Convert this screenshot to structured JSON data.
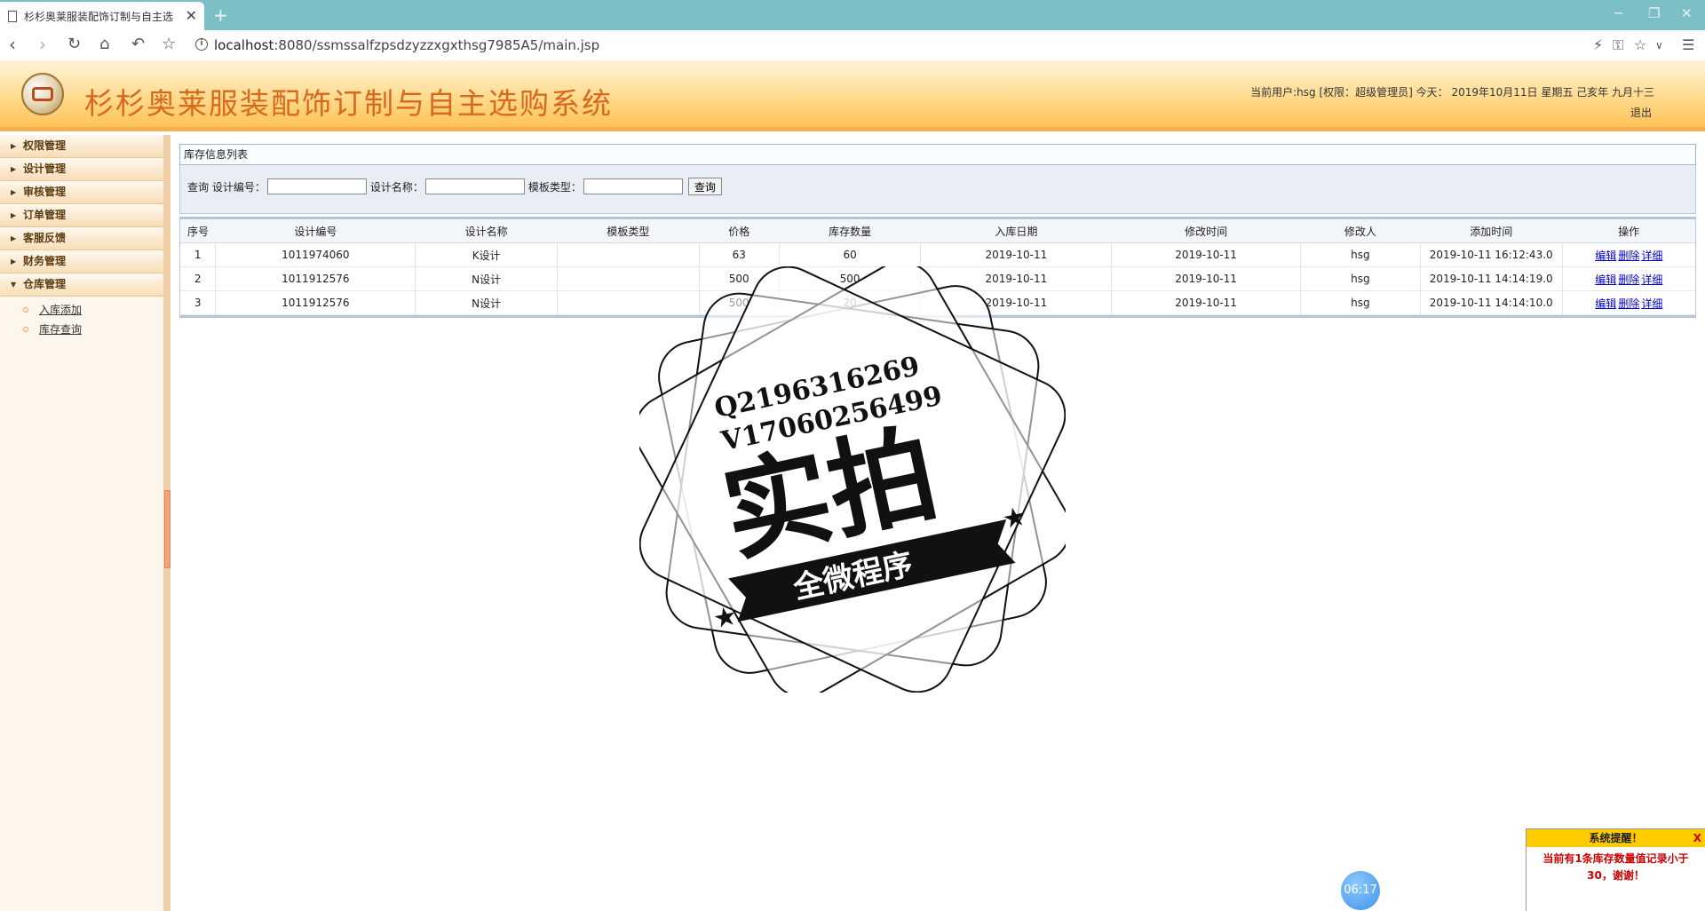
{
  "browser": {
    "tab_title": "杉杉奥莱服装配饰订制与自主选",
    "url_host": "localhost",
    "url_rest": ":8080/ssmssalfzpsdzyzzxgxthsg7985A5/main.jsp"
  },
  "header": {
    "title": "杉杉奥莱服装配饰订制与自主选购系统",
    "user_info": "当前用户:hsg [权限：超级管理员] 今天： 2019年10月11日 星期五 己亥年 九月十三",
    "logout": "退出"
  },
  "sidebar": {
    "menus": [
      {
        "label": "权限管理"
      },
      {
        "label": "设计管理"
      },
      {
        "label": "审核管理"
      },
      {
        "label": "订单管理"
      },
      {
        "label": "客服反馈"
      },
      {
        "label": "财务管理"
      },
      {
        "label": "仓库管理"
      }
    ],
    "submenu": [
      {
        "label": "入库添加"
      },
      {
        "label": "库存查询"
      }
    ]
  },
  "panel": {
    "title": "库存信息列表",
    "search": {
      "prefix": "查询",
      "label_code": "设计编号：",
      "label_name": "设计名称：",
      "label_type": "模板类型：",
      "button": "查询"
    }
  },
  "table": {
    "headers": [
      "序号",
      "设计编号",
      "设计名称",
      "模板类型",
      "价格",
      "库存数量",
      "入库日期",
      "修改时间",
      "修改人",
      "添加时间",
      "操作"
    ],
    "rows": [
      {
        "no": "1",
        "code": "1011974060",
        "name": "K设计",
        "type": "",
        "price": "63",
        "qty": "60",
        "in_date": "2019-10-11",
        "mod_date": "2019-10-11",
        "modifier": "hsg",
        "added": "2019-10-11 16:12:43.0"
      },
      {
        "no": "2",
        "code": "1011912576",
        "name": "N设计",
        "type": "",
        "price": "500",
        "qty": "500",
        "in_date": "2019-10-11",
        "mod_date": "2019-10-11",
        "modifier": "hsg",
        "added": "2019-10-11 14:14:19.0"
      },
      {
        "no": "3",
        "code": "1011912576",
        "name": "N设计",
        "type": "",
        "price": "500",
        "qty": "20",
        "in_date": "2019-10-11",
        "mod_date": "2019-10-11",
        "modifier": "hsg",
        "added": "2019-10-11 14:14:10.0"
      }
    ],
    "ops": {
      "edit": "编辑",
      "delete": "删除",
      "detail": "详细"
    }
  },
  "watermark": {
    "line1": "Q2196316269",
    "line2": "V17060256499",
    "big": "实拍",
    "banner": "全微程序"
  },
  "notice": {
    "title": "系统提醒！",
    "close": "X",
    "body": "当前有1条库存数量值记录小于30，谢谢！"
  },
  "timer": "06:17"
}
